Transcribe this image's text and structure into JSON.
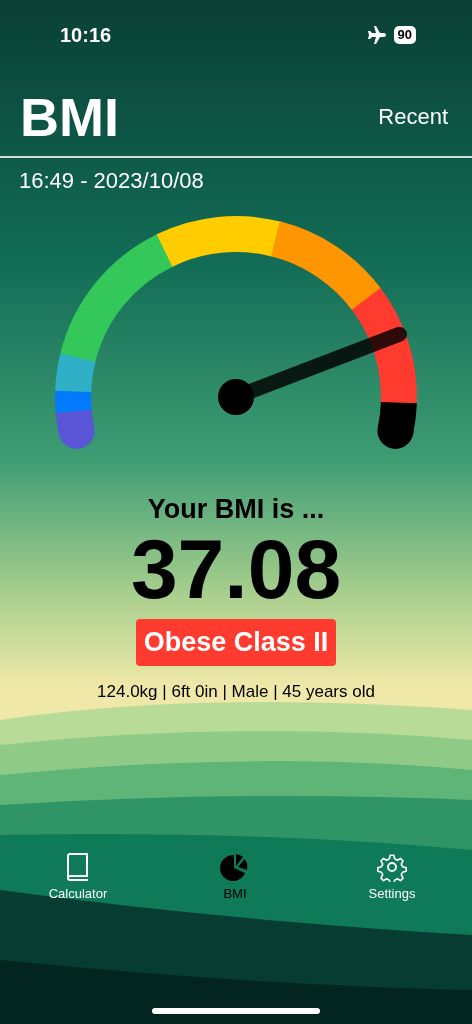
{
  "status_bar": {
    "time": "10:16",
    "battery": "90"
  },
  "header": {
    "title": "BMI",
    "action": "Recent"
  },
  "timestamp": "16:49 - 2023/10/08",
  "result": {
    "heading": "Your BMI is ...",
    "value": "37.08",
    "category": "Obese Class II",
    "details": "124.0kg | 6ft 0in | Male | 45 years old"
  },
  "tab_bar": [
    {
      "label": "Calculator",
      "kind": "book",
      "selected": false
    },
    {
      "label": "BMI",
      "kind": "pie",
      "selected": true
    },
    {
      "label": "Settings",
      "kind": "gear",
      "selected": false
    }
  ]
}
